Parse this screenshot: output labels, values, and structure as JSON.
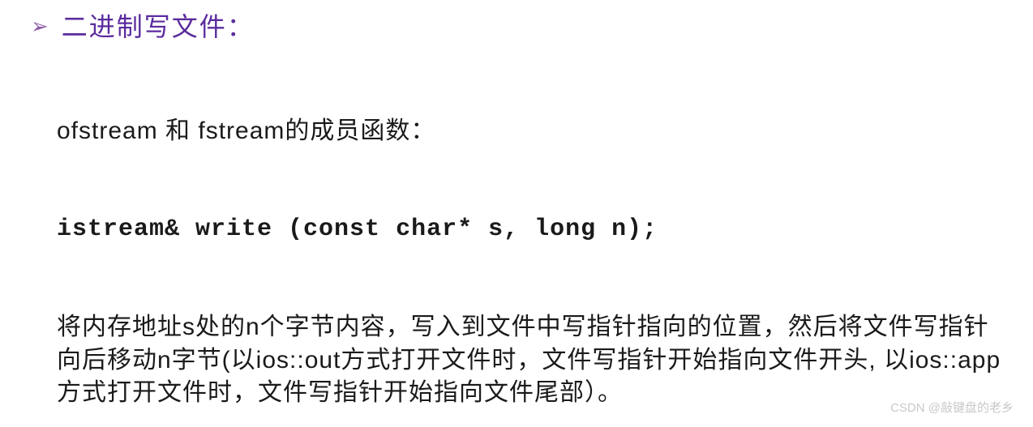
{
  "heading": "二进制写文件：",
  "members_intro": "ofstream 和 fstream的成员函数：",
  "code_signature": "istream& write (const char* s, long n);",
  "description": " 将内存地址s处的n个字节内容，写入到文件中写指针指向的位置，然后将文件写指针向后移动n字节(以ios::out方式打开文件时，文件写指针开始指向文件开头, 以ios::app方式打开文件时，文件写指针开始指向文件尾部）。",
  "watermark": "CSDN @敲键盘的老乡"
}
